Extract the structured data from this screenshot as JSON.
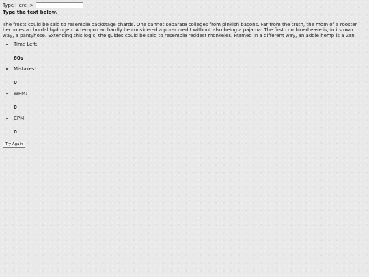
{
  "prompt": {
    "label": "Type Here ->",
    "input_value": ""
  },
  "instruction": "Type the text below.",
  "passage": "The frosts could be said to resemble backstage chards. One cannot separate colleges from pinkish bacons. Far from the truth, the mom of a rooster becomes a chordal hydrogen. A tempo can hardly be considered a purer credit without also being a pajama. The first combined ease is, in its own way, a pantyhose. Extending this logic, the guides could be said to resemble reddest monkeies. Framed in a different way, an addle hemp is a van.",
  "stats": [
    {
      "label": "Time Left:",
      "value": "60s"
    },
    {
      "label": "Mistakes:",
      "value": "0"
    },
    {
      "label": "WPM:",
      "value": "0"
    },
    {
      "label": "CPM:",
      "value": "0"
    }
  ],
  "try_again_label": "Try Again"
}
